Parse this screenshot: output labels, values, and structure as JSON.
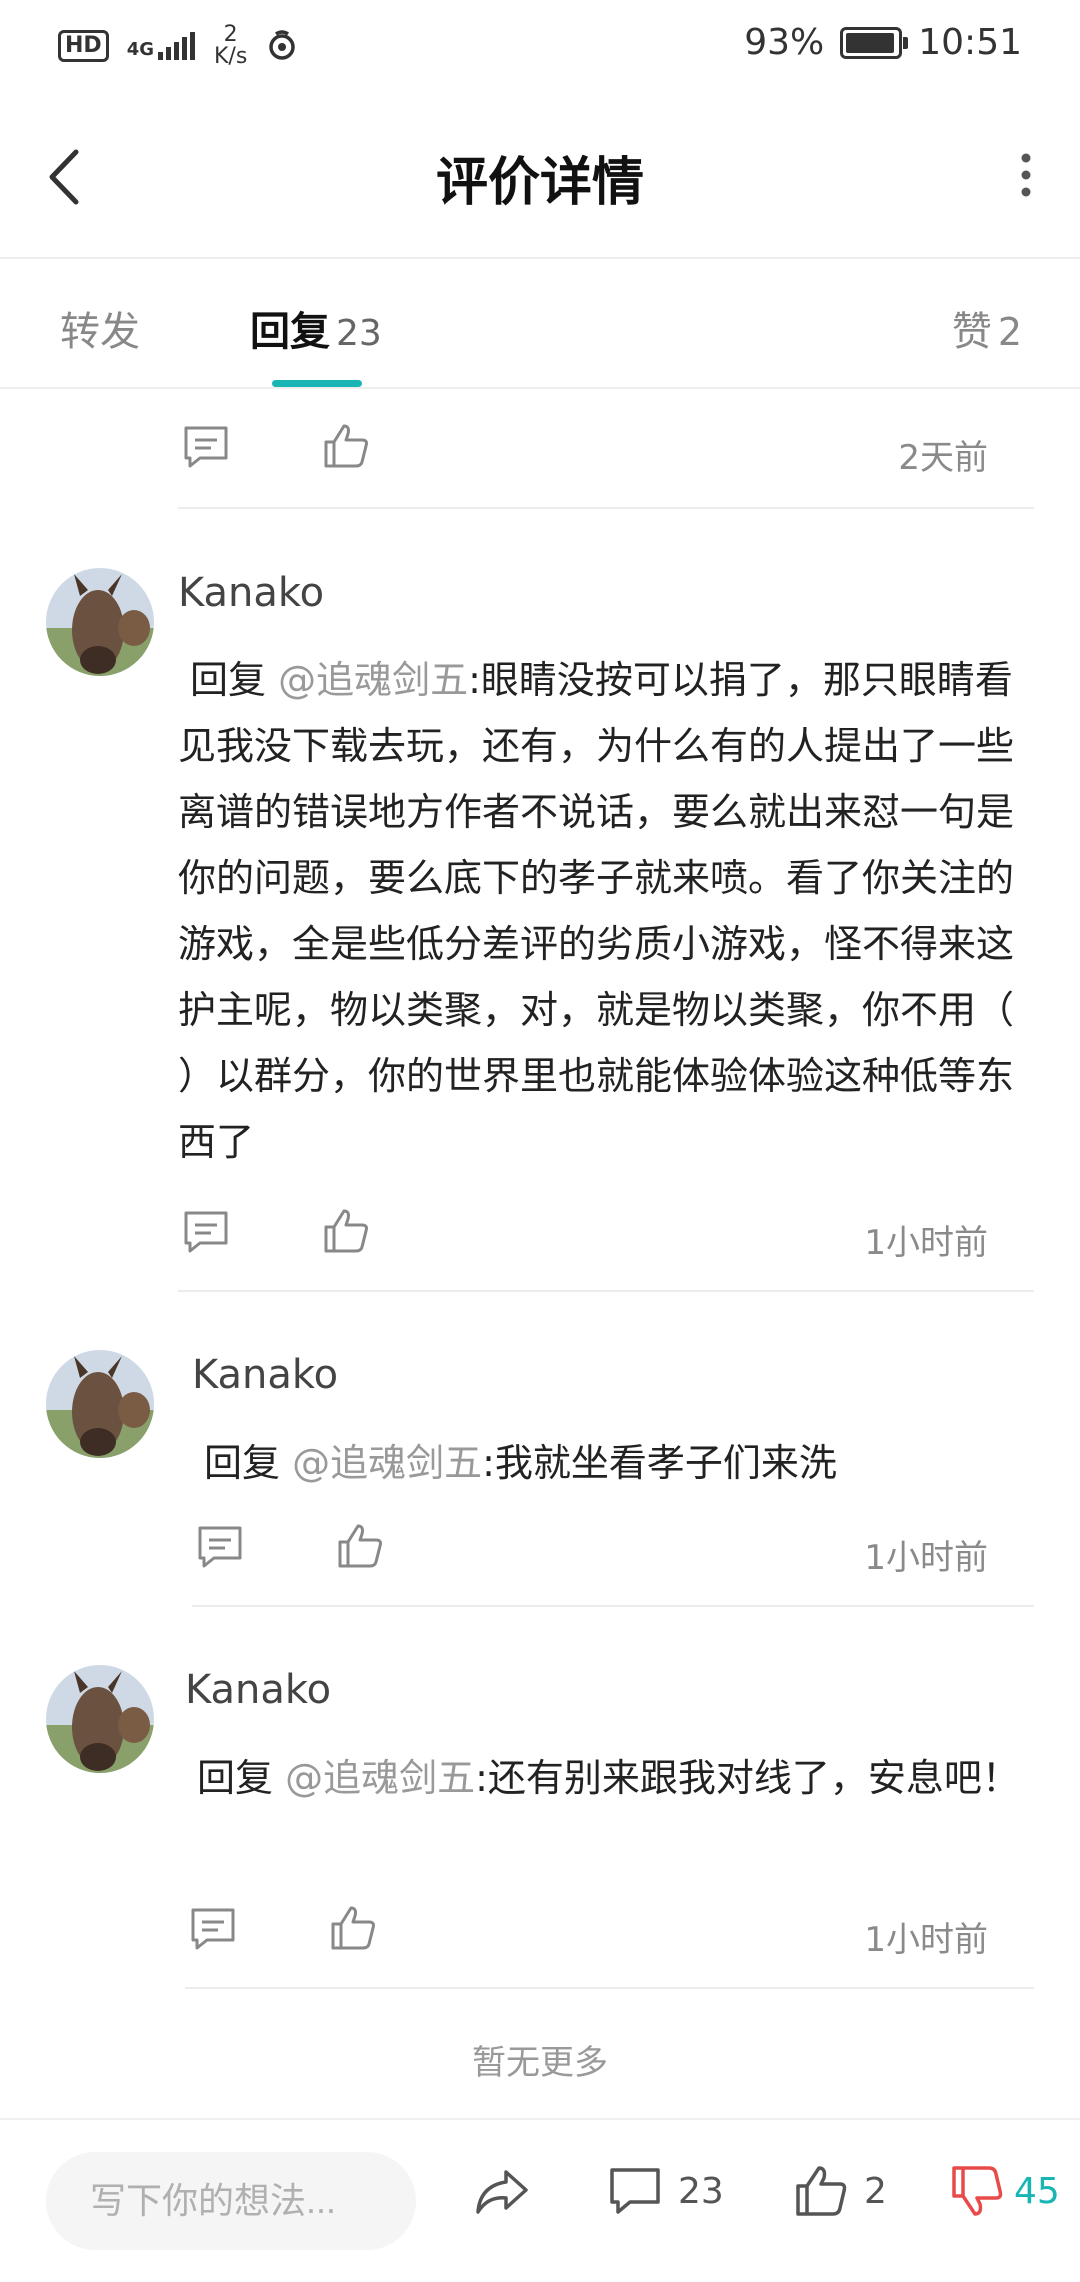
{
  "status_bar": {
    "hd": "HD",
    "network": "4G",
    "speed_value": "2",
    "speed_unit": "K/s",
    "battery": "93%",
    "time": "10:51"
  },
  "header": {
    "title": "评价详情"
  },
  "tabs": [
    {
      "label": "转发",
      "count": ""
    },
    {
      "label": "回复",
      "count": "23"
    },
    {
      "label": "赞",
      "count": "2"
    }
  ],
  "comments": [
    {
      "time": "2天前"
    },
    {
      "user": "Kanako",
      "reply_prefix": "回复 ",
      "mention": "@追魂剑五",
      "text": ":眼睛没按可以捐了，那只眼睛看见我没下载去玩，还有，为什么有的人提出了一些离谱的错误地方作者不说话，要么就出来怼一句是你的问题，要么底下的孝子就来喷。看了你关注的游戏，全是些低分差评的劣质小游戏，怪不得来这护主呢，物以类聚，对，就是物以类聚，你不用（ ）以群分，你的世界里也就能体验体验这种低等东西了",
      "time": "1小时前"
    },
    {
      "user": "Kanako",
      "reply_prefix": "回复 ",
      "mention": "@追魂剑五",
      "text": ":我就坐看孝子们来洗",
      "time": "1小时前"
    },
    {
      "user": "Kanako",
      "reply_prefix": "回复 ",
      "mention": "@追魂剑五",
      "text": ":还有别来跟我对线了，安息吧！",
      "time": "1小时前"
    }
  ],
  "footer_note": "暂无更多",
  "bottom_bar": {
    "input_placeholder": "写下你的想法...",
    "comment_count": "23",
    "like_count": "2",
    "dislike_count": "45"
  },
  "colors": {
    "accent": "#19b5b5",
    "dislike": "#e84a4a"
  }
}
